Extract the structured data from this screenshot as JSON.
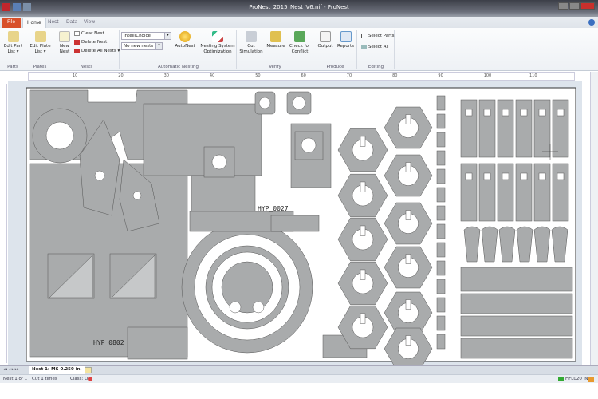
{
  "window": {
    "title": "ProNest_2015_Nest_V6.nif - ProNest"
  },
  "tabs": [
    "File",
    "Home",
    "Nest",
    "Data",
    "View"
  ],
  "ribbon": {
    "parts": {
      "edit_part_list": "Edit Part List ▾",
      "group": "Parts"
    },
    "plates": {
      "edit_plate_list": "Edit Plate List ▾",
      "group": "Plates"
    },
    "nests": {
      "new_nest": "New Nest",
      "clear_nest": "Clear Nest",
      "delete_nest": "Delete Nest",
      "delete_all_nests": "Delete All Nests ▾",
      "group": "Nests"
    },
    "auto": {
      "strategy": "IntelliChoice",
      "new_nests": "No new nests",
      "autonest": "AutoNest",
      "optimization": "Nesting System Optimization",
      "group": "Automatic Nesting"
    },
    "verify": {
      "cut_simulation": "Cut Simulation",
      "measure": "Measure",
      "check_conflict": "Check for Conflict",
      "group": "Verify"
    },
    "produce": {
      "output": "Output",
      "reports": "Reports",
      "group": "Produce"
    },
    "editing": {
      "select_parts": "Select Parts",
      "select_all": "Select All",
      "group": "Editing"
    }
  },
  "ruler": {
    "labels": [
      "10",
      "20",
      "30",
      "40",
      "50",
      "60",
      "70",
      "80",
      "90",
      "100",
      "110"
    ]
  },
  "nest": {
    "part_labels": [
      "HYP_0027",
      "HYP_0802"
    ]
  },
  "sheet_tab": "Nest 1: MS 0.250 in.",
  "status": {
    "nest": "Nest 1 of 1",
    "cut": "Cut 1 times",
    "class": "Class: O2",
    "license": "HFL020 IN"
  },
  "colors": {
    "part": "#a9abac",
    "plate": "#ffffff",
    "file_tab": "#d8502a"
  }
}
